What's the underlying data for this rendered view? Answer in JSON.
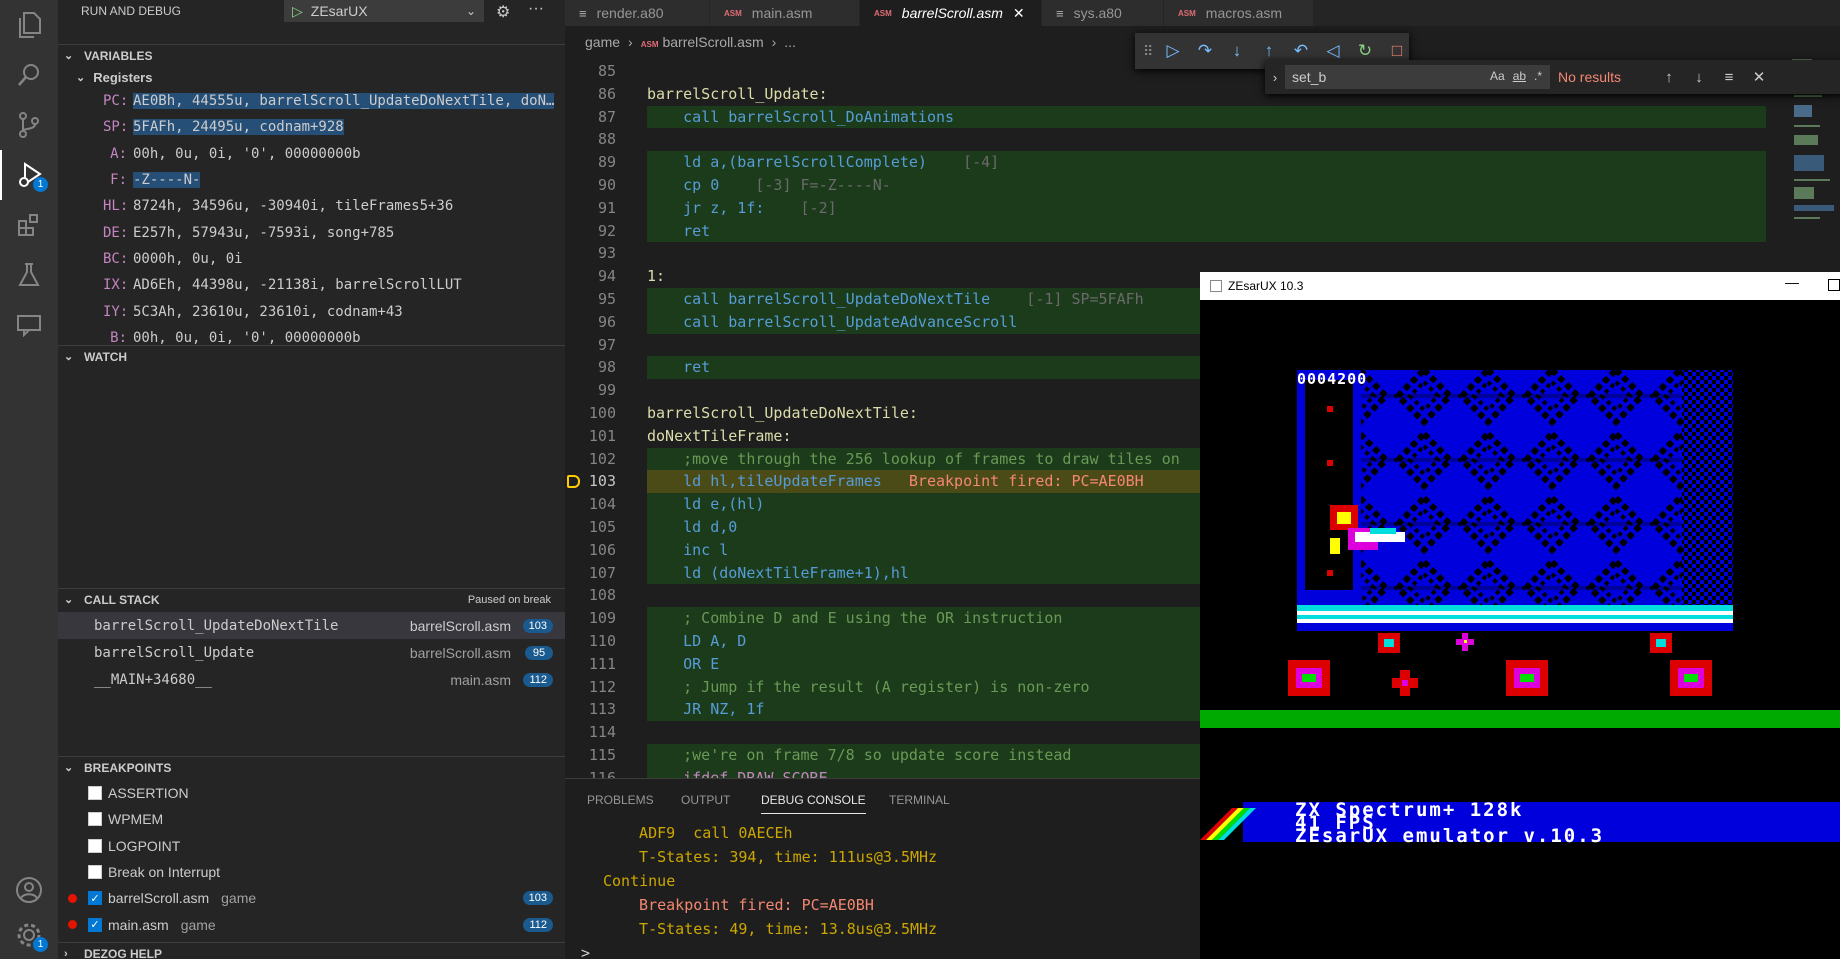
{
  "run_debug": {
    "title": "RUN AND DEBUG",
    "config": "ZEsarUX"
  },
  "activity": {
    "debug_badge": "1",
    "settings_badge": "1"
  },
  "variables": {
    "title": "VARIABLES",
    "registers_title": "Registers",
    "registers": [
      {
        "name": "PC:",
        "value": "AE0Bh, 44555u, barrelScroll_UpdateDoNextTile, doN…"
      },
      {
        "name": "SP:",
        "value": "5FAFh, 24495u, codnam+928"
      },
      {
        "name": "A:",
        "value": "00h, 0u, 0i, '0', 00000000b"
      },
      {
        "name": "F:",
        "value": "-Z----N-"
      },
      {
        "name": "HL:",
        "value": "8724h, 34596u, -30940i, tileFrames5+36"
      },
      {
        "name": "DE:",
        "value": "E257h, 57943u, -7593i, song+785"
      },
      {
        "name": "BC:",
        "value": "0000h, 0u, 0i"
      },
      {
        "name": "IX:",
        "value": "AD6Eh, 44398u, -21138i, barrelScrollLUT"
      },
      {
        "name": "IY:",
        "value": "5C3Ah, 23610u, 23610i, codnam+43"
      },
      {
        "name": "B:",
        "value": "00h, 0u, 0i, '0', 00000000b"
      }
    ]
  },
  "watch": {
    "title": "WATCH"
  },
  "call_stack": {
    "title": "CALL STACK",
    "status": "Paused on break",
    "frames": [
      {
        "name": "barrelScroll_UpdateDoNextTile",
        "file": "barrelScroll.asm",
        "line": "103"
      },
      {
        "name": "barrelScroll_Update",
        "file": "barrelScroll.asm",
        "line": "95"
      },
      {
        "name": "__MAIN+34680__",
        "file": "main.asm",
        "line": "112"
      }
    ]
  },
  "breakpoints": {
    "title": "BREAKPOINTS",
    "items": [
      {
        "label": "ASSERTION"
      },
      {
        "label": "WPMEM"
      },
      {
        "label": "LOGPOINT"
      },
      {
        "label": "Break on Interrupt"
      },
      {
        "label": "barrelScroll.asm",
        "folder": "game",
        "line": "103"
      },
      {
        "label": "main.asm",
        "folder": "game",
        "line": "112"
      }
    ]
  },
  "dezog_help": {
    "title": "DEZOG HELP"
  },
  "tabs": [
    {
      "label": "render.a80"
    },
    {
      "label": "main.asm",
      "icon": "ASM"
    },
    {
      "label": "barrelScroll.asm",
      "icon": "ASM"
    },
    {
      "label": "sys.a80"
    },
    {
      "label": "macros.asm",
      "icon": "ASM"
    }
  ],
  "breadcrumb": {
    "folder": "game",
    "icon": "ASM",
    "file": "barrelScroll.asm",
    "more": "..."
  },
  "find": {
    "value": "set_b",
    "opt_case": "Aa",
    "opt_word": "ab",
    "opt_regex": ".*",
    "result": "No results"
  },
  "code_lines": [
    {
      "n": "85",
      "text": ""
    },
    {
      "n": "86",
      "text": "barrelScroll_Update:"
    },
    {
      "n": "87",
      "text": "    call barrelScroll_DoAnimations"
    },
    {
      "n": "88",
      "text": ""
    },
    {
      "n": "89",
      "text": "    ld a,(barrelScrollComplete)",
      "hint": "    [-4]"
    },
    {
      "n": "90",
      "text": "    cp 0",
      "hint": "    [-3] F=-Z----N-"
    },
    {
      "n": "91",
      "text": "    jr z, 1f:",
      "hint": "    [-2]"
    },
    {
      "n": "92",
      "text": "    ret"
    },
    {
      "n": "93",
      "text": ""
    },
    {
      "n": "94",
      "text": "1:"
    },
    {
      "n": "95",
      "text": "    call barrelScroll_UpdateDoNextTile",
      "hint": "    [-1] SP=5FAFh"
    },
    {
      "n": "96",
      "text": "    call barrelScroll_UpdateAdvanceScroll"
    },
    {
      "n": "97",
      "text": ""
    },
    {
      "n": "98",
      "text": "    ret"
    },
    {
      "n": "99",
      "text": ""
    },
    {
      "n": "100",
      "text": "barrelScroll_UpdateDoNextTile:"
    },
    {
      "n": "101",
      "text": "doNextTileFrame:"
    },
    {
      "n": "102",
      "text": "    ;move through the 256 lookup of frames to draw tiles on"
    },
    {
      "n": "103",
      "text": "    ld hl,tileUpdateFrames",
      "bp": "   Breakpoint fired: PC=AE0BH"
    },
    {
      "n": "104",
      "text": "    ld e,(hl)"
    },
    {
      "n": "105",
      "text": "    ld d,0"
    },
    {
      "n": "106",
      "text": "    inc l"
    },
    {
      "n": "107",
      "text": "    ld (doNextTileFrame+1),hl"
    },
    {
      "n": "108",
      "text": ""
    },
    {
      "n": "109",
      "text": "    ; Combine D and E using the OR instruction"
    },
    {
      "n": "110",
      "text": "    LD A, D"
    },
    {
      "n": "111",
      "text": "    OR E"
    },
    {
      "n": "112",
      "text": "    ; Jump if the result (A register) is non-zero"
    },
    {
      "n": "113",
      "text": "    JR NZ, 1f"
    },
    {
      "n": "114",
      "text": ""
    },
    {
      "n": "115",
      "text": "    ;we're on frame 7/8 so update score instead"
    },
    {
      "n": "116",
      "text": "    ifdef DRAW_SCORE"
    }
  ],
  "panel": {
    "tabs": [
      "PROBLEMS",
      "OUTPUT",
      "DEBUG CONSOLE",
      "TERMINAL"
    ],
    "console": [
      "  ADF9  call 0AECEh",
      "  T-States: 394, time: 111us@3.5MHz",
      "Continue",
      "  Breakpoint fired: PC=AE0BH",
      "  T-States: 49, time: 13.8us@3.5MHz"
    ],
    "prompt": ">"
  },
  "emulator": {
    "title": "ZEsarUX 10.3",
    "score": "0004200",
    "status_lines": [
      "ZX Spectrum+ 128k",
      "41 FPS",
      "ZEsarUX emulator v.10.3"
    ]
  }
}
